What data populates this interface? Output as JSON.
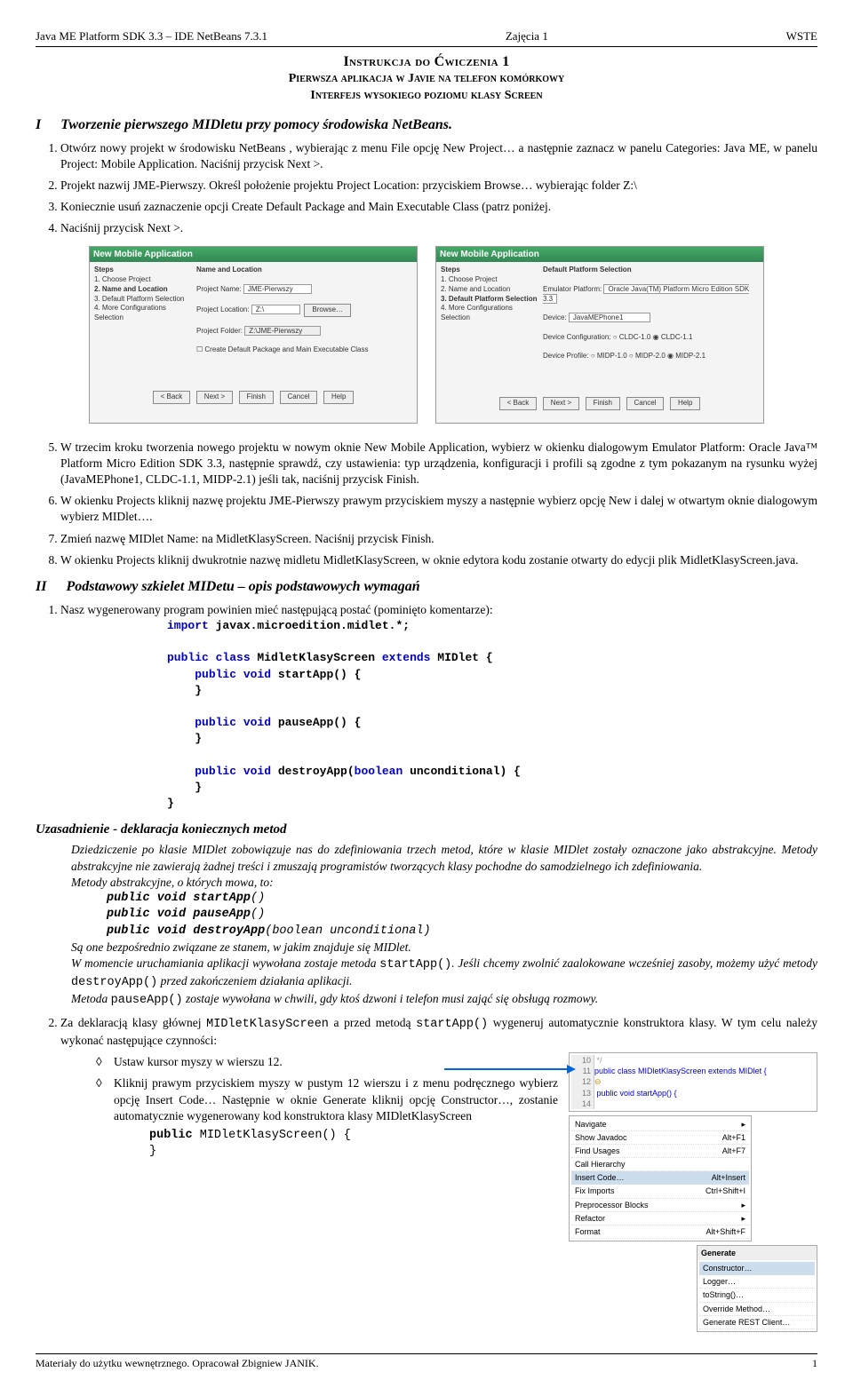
{
  "header": {
    "left": "Java ME Platform SDK 3.3 – IDE NetBeans 7.3.1",
    "center": "Zajęcia 1",
    "right": "WSTE"
  },
  "title": {
    "main": "Instrukcja do Ćwiczenia 1",
    "sub1": "Pierwsza aplikacja w Javie na telefon komórkowy",
    "sub2": "Interfejs wysokiego poziomu klasy Screen"
  },
  "sectionI": {
    "num": "I",
    "heading": "Tworzenie pierwszego MIDletu przy pomocy środowiska NetBeans.",
    "items": [
      "Otwórz nowy projekt w środowisku NetBeans , wybierając z menu File opcję New Project… a następnie zaznacz w panelu Categories: Java ME, w panelu Project: Mobile Application. Naciśnij przycisk Next >.",
      "Projekt nazwij JME-Pierwszy. Określ położenie projektu Project Location: przyciskiem Browse… wybierając folder Z:\\",
      "Koniecznie usuń zaznaczenie opcji Create Default Package and Main Executable Class (patrz poniżej.",
      "Naciśnij przycisk Next >."
    ],
    "dlg": {
      "title": "New Mobile Application",
      "stepsHead": "Steps",
      "stepsA": [
        "1. Choose Project",
        "2. Name and Location",
        "3. Default Platform Selection",
        "4. More Configurations Selection"
      ],
      "nameLocHead": "Name and Location",
      "projNameLabel": "Project Name:",
      "projNameVal": "JME-Pierwszy",
      "projLocLabel": "Project Location:",
      "projLocVal": "Z:\\",
      "browse": "Browse…",
      "projFolderLabel": "Project Folder:",
      "projFolderVal": "Z:\\JME-Pierwszy",
      "chk": "Create Default Package and Main Executable Class",
      "platHead": "Default Platform Selection",
      "emLabel": "Emulator Platform:",
      "emVal": "Oracle Java(TM) Platform Micro Edition SDK 3.3",
      "devLabel": "Device:",
      "devVal": "JavaMEPhone1",
      "cfgLabel": "Device Configuration:",
      "cfgA": "CLDC-1.0",
      "cfgB": "CLDC-1.1",
      "profLabel": "Device Profile:",
      "profA": "MIDP-1.0",
      "profB": "MIDP-2.0",
      "profC": "MIDP-2.1",
      "btns": {
        "back": "< Back",
        "next": "Next >",
        "finish": "Finish",
        "cancel": "Cancel",
        "help": "Help"
      }
    },
    "post": [
      "W trzecim kroku tworzenia nowego projektu w nowym oknie New Mobile Application, wybierz w okienku dialogowym Emulator Platform: Oracle Java™ Platform Micro Edition SDK 3.3, następnie sprawdź, czy ustawienia: typ urządzenia, konfiguracji i profili są zgodne z tym pokazanym na rysunku wyżej (JavaMEPhone1, CLDC-1.1, MIDP-2.1) jeśli tak, naciśnij przycisk Finish.",
      "W okienku Projects kliknij nazwę projektu JME-Pierwszy prawym przyciskiem myszy a następnie wybierz opcję New i dalej w otwartym oknie dialogowym wybierz MIDlet….",
      "Zmień nazwę MIDlet Name: na MidletKlasyScreen. Naciśnij przycisk Finish.",
      "W okienku Projects kliknij dwukrotnie nazwę midletu MidletKlasyScreen, w oknie edytora kodu zostanie otwarty do edycji plik MidletKlasyScreen.java."
    ]
  },
  "sectionII": {
    "num": "II",
    "heading": "Podstawowy szkielet MIDetu – opis podstawowych wymagań",
    "item1": "Nasz wygenerowany program powinien mieć następującą postać (pominięto komentarze):",
    "code1": {
      "l1a": "import",
      "l1b": " javax.microedition.midlet.*;",
      "l2a": "public class ",
      "l2b": "MidletKlasyScreen ",
      "l2c": "extends",
      "l2d": " MIDlet {",
      "l3a": "public void ",
      "l3b": "startApp() {",
      "l4": "}",
      "l5a": "public void ",
      "l5b": "pauseApp() {",
      "l6": "}",
      "l7a": "public void ",
      "l7b": "destroyApp(",
      "l7c": "boolean",
      "l7d": " unconditional) {",
      "l8": "}",
      "l9": "}"
    },
    "uzHead": "Uzasadnienie - deklaracja koniecznych metod",
    "uz1": "Dziedziczenie po klasie MIDlet zobowiązuje nas do zdefiniowania trzech metod, które w klasie MIDlet zostały oznaczone jako abstrakcyjne. Metody abstrakcyjne nie zawierają żadnej treści i zmuszają programistów tworzących klasy pochodne do samodzielnego ich zdefiniowania.",
    "uz2": "Metody abstrakcyjne, o których mowa, to:",
    "m1a": "public void ",
    "m1b": "startApp",
    "m1c": "()",
    "m2a": "public void ",
    "m2b": "pauseApp",
    "m2c": "()",
    "m3a": "public void ",
    "m3b": "destroyApp",
    "m3c": "(boolean unconditional)",
    "uz3": "Są one bezpośrednio związane ze stanem, w jakim znajduje się MIDlet.",
    "uz4a": "W momencie uruchamiania aplikacji wywołana zostaje metoda ",
    "uz4b": "startApp()",
    "uz4c": ". Jeśli chcemy zwolnić zaalokowane wcześniej zasoby, możemy użyć metody ",
    "uz4d": "destroyApp()",
    "uz4e": " przed zakończeniem działania aplikacji.",
    "uz5a": "Metoda ",
    "uz5b": "pauseApp()",
    "uz5c": " zostaje wywołana w chwili, gdy ktoś dzwoni i telefon musi zająć się obsługą rozmowy.",
    "item2a": "Za deklaracją klasy głównej ",
    "item2b": "MIDletKlasyScreen",
    "item2c": "  a przed metodą ",
    "item2d": "startApp()",
    "item2e": " wygeneruj automatycznie konstruktora klasy. W tym celu należy wykonać następujące czynności:",
    "dia1": "Ustaw kursor myszy w wierszu 12.",
    "dia2": "Kliknij prawym przyciskiem myszy w pustym 12 wierszu i z menu podręcznego wybierz opcję Insert Code…  Następnie w oknie Generate kliknij opcję Constructor…, zostanie automatycznie wygenerowany kod konstruktora klasy MIDletKlasyScreen",
    "ctorA": "public ",
    "ctorB": "MIDletKlasyScreen() {",
    "ctorC": "}",
    "codeImg": {
      "l10": "10",
      "l10t": "        */",
      "l11": "11",
      "l11t": "public class MIDletKlasyScreen extends MIDlet {",
      "l12": "12",
      "l13": "13",
      "l13t": "    public void startApp() {",
      "l14": "14"
    },
    "menu": {
      "navigate": "Navigate",
      "showjd": "Show Javadoc",
      "showjdK": "Alt+F1",
      "findu": "Find Usages",
      "finduK": "Alt+F7",
      "callh": "Call Hierarchy",
      "insert": "Insert Code…",
      "insertK": "Alt+Insert",
      "fix": "Fix Imports",
      "fixK": "Ctrl+Shift+I",
      "pre": "Preprocessor Blocks",
      "ref": "Refactor",
      "fmt": "Format",
      "fmtK": "Alt+Shift+F"
    },
    "gen": {
      "title": "Generate",
      "c": "Constructor…",
      "log": "Logger…",
      "ts": "toString()…",
      "ov": "Override Method…",
      "rest": "Generate REST Client…"
    }
  },
  "footer": {
    "left": "Materiały do użytku wewnętrznego. Opracował Zbigniew JANIK.",
    "right": "1"
  }
}
